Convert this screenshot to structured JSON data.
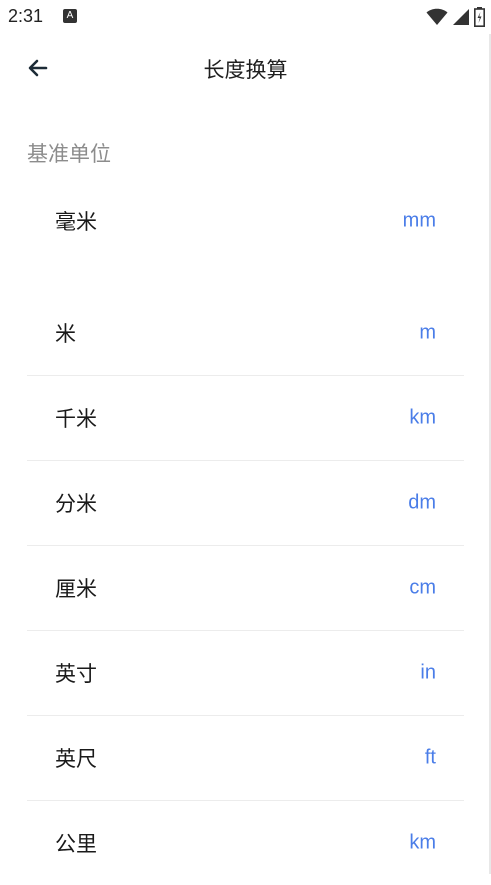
{
  "status": {
    "time": "2:31",
    "app_icon": "A"
  },
  "app_bar": {
    "title": "长度换算"
  },
  "section": {
    "header": "基准单位"
  },
  "base_unit": {
    "name": "毫米",
    "symbol": "mm"
  },
  "units": [
    {
      "name": "米",
      "symbol": "m"
    },
    {
      "name": "千米",
      "symbol": "km"
    },
    {
      "name": "分米",
      "symbol": "dm"
    },
    {
      "name": "厘米",
      "symbol": "cm"
    },
    {
      "name": "英寸",
      "symbol": "in"
    },
    {
      "name": "英尺",
      "symbol": "ft"
    },
    {
      "name": "公里",
      "symbol": "km"
    }
  ],
  "colors": {
    "accent": "#4a7de8",
    "section_header": "#8c8c8c",
    "divider": "#ececec"
  }
}
